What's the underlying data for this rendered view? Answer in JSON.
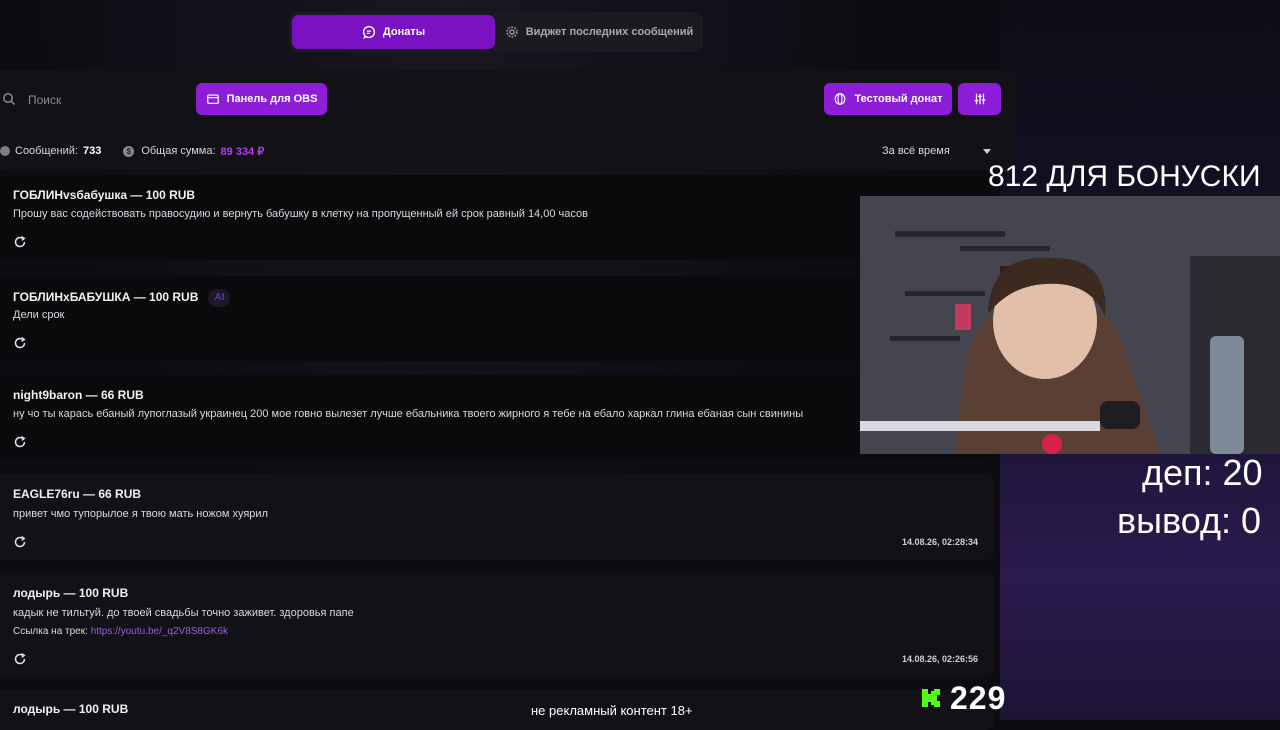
{
  "tabs": [
    {
      "label": "Донаты",
      "icon": "chat-bubble-icon",
      "active": true
    },
    {
      "label": "Виджет последних сообщений",
      "icon": "gear-icon",
      "active": false
    }
  ],
  "toolbar": {
    "search_placeholder": "Поиск",
    "obs_panel_label": "Панель для OBS",
    "test_donation_label": "Тестовый донат",
    "settings_icon": "sliders-icon"
  },
  "stats": {
    "messages_label": "Сообщений:",
    "messages_count": "733",
    "sum_label": "Общая сумма:",
    "sum_value": "89 334 ₽",
    "period": "За всё время"
  },
  "messages": [
    {
      "header": "ГОБЛИНvsбабушка — 100 RUB",
      "text": "Прошу вас содействовать правосудию и вернуть бабушку в клетку на пропущенный ей срок равный 14,00 часов",
      "time": ""
    },
    {
      "header": "ГОБЛИНхБАБУШКА — 100 RUB",
      "badge": "AI",
      "text": "Дели срок",
      "time": ""
    },
    {
      "header": "night9baron — 66 RUB",
      "text": "ну чо ты карась ебаный лупоглазый украинец 200 мое говно вылезет лучше ебальника твоего жирного я тебе на ебало харкал глина ебаная сын свинины",
      "time": ""
    },
    {
      "header": "EAGLE76ru — 66 RUB",
      "text": "привет чмо тупорылое я твою мать ножом хуярил",
      "time": "14.08.26, 02:28:34"
    },
    {
      "header": "лодырь — 100 RUB",
      "text": "кадык не тильтуй. до твоей свадьбы точно заживет. здоровья папе",
      "link_label": "Ссылка на трек:",
      "link_url": "https://youtu.be/_q2V8S8GK6k",
      "time": "14.08.26, 02:26:56"
    },
    {
      "header": "лодырь — 100 RUB",
      "text": "",
      "time": ""
    }
  ],
  "overlay": {
    "bonus_text": "812 ДЛЯ БОНУСКИ",
    "deposit_text": "деп: 20",
    "withdraw_text": "вывод: 0",
    "viewer_count": "229",
    "disclaimer": "не рекламный контент 18+"
  },
  "colors": {
    "accent": "#8b1ed6",
    "tab_active": "#7a12c4",
    "sum_color": "#b33cf0",
    "kick_green": "#53fc18"
  }
}
